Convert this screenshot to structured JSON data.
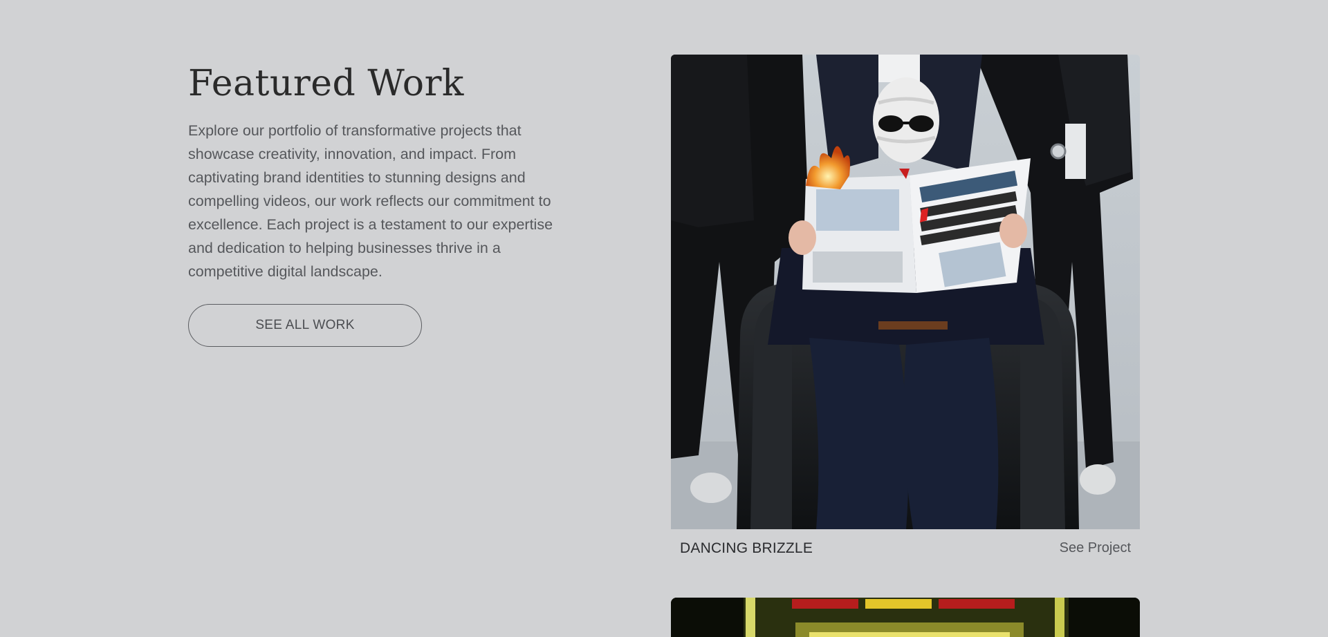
{
  "featured": {
    "title": "Featured Work",
    "description": "Explore our portfolio of transformative projects that showcase creativity, innovation, and impact. From captivating brand identities to stunning designs and compelling videos, our work reflects our commitment to excellence. Each project is a testament to our expertise and dedication to helping businesses thrive in a competitive digital landscape.",
    "cta_label": "SEE ALL WORK"
  },
  "projects": [
    {
      "name": "DANCING BRIZZLE",
      "link_label": "See Project",
      "image": "project-photo"
    },
    {
      "image": "project-photo"
    }
  ],
  "colors": {
    "background": "#d1d2d4",
    "heading": "#2a2a2a",
    "body_text": "#55575b"
  }
}
